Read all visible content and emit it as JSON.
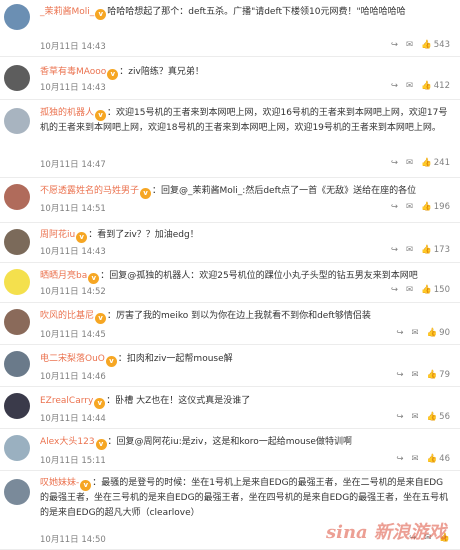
{
  "comments": [
    {
      "user": "_茉莉酱Moli_",
      "body": "哈哈哈想起了那个：deft五杀。广播\"请deft下楼领10元网费！\"哈哈哈哈哈",
      "time": "10月11日 14:43",
      "likes": "543",
      "avatar_color": "#6b8fb3"
    },
    {
      "user": "香草有毒MAooo",
      "body": "：ziv陪练？真兄弟！",
      "time": "10月11日 14:43",
      "likes": "412",
      "avatar_color": "#5d5d5d"
    },
    {
      "user": "孤独的机器人",
      "body": "：欢迎15号机的王者来到本网吧上网，欢迎16号机的王者来到本网吧上网，欢迎17号机的王者来到本网吧上网，欢迎18号机的王者来到本网吧上网，欢迎19号机的王者来到本网吧上网。",
      "time": "10月11日 14:47",
      "likes": "241",
      "avatar_color": "#a8b4c0"
    },
    {
      "user": "不愿透露姓名的马姓男子",
      "body": "：回复@_茉莉酱Moli_:然后deft点了一首《无敌》送给在座的各位",
      "time": "10月11日 14:51",
      "likes": "196",
      "avatar_color": "#b06b5b"
    },
    {
      "user": "周阿花iu",
      "body": "：看到了ziv？？加油edg！",
      "time": "10月11日 14:43",
      "likes": "173",
      "avatar_color": "#7b6a5a"
    },
    {
      "user": "晒晒月亮ba",
      "body": "：回复@孤独的机器人：欢迎25号机位的踝位小丸子头型的钻五男友来到本网吧",
      "time": "10月11日 14:52",
      "likes": "150",
      "avatar_color": "#f4e04d"
    },
    {
      "user": "吹风的比基尼",
      "body": "：厉害了我的meiko 到以为你在边上我就看不到你和deft够情侣装",
      "time": "10月11日 14:45",
      "likes": "90",
      "avatar_color": "#8a6a5a"
    },
    {
      "user": "电二宋梨落OuO",
      "body": "：扣肉和ziv一起帮mouse解",
      "time": "10月11日 14:46",
      "likes": "79",
      "avatar_color": "#6a7a8a"
    },
    {
      "user": "EZrealCarry",
      "body": "：卧槽 大Z也在！这仪式真是没谁了",
      "time": "10月11日 14:44",
      "likes": "56",
      "avatar_color": "#3a3a4a"
    },
    {
      "user": "Alex大头123",
      "body": "：回复@周阿花iu:是ziv，这是和koro一起给mouse做特训啊",
      "time": "10月11日 15:11",
      "likes": "46",
      "avatar_color": "#9ab0c0"
    },
    {
      "user": "叹她妹妹-",
      "body": "：最骚的是登号的时候：坐在1号机上是来自EDG的最强王者，坐在二号机的是来自EDG的最强王者，坐在三号机的是来自EDG的最强王者，坐在四号机的是来自EDG的最强王者，坐在五号机的是来自EDG的超凡大师（clearlove）",
      "time": "10月11日 14:50",
      "likes": "",
      "avatar_color": "#7a8a9a"
    }
  ],
  "watermark": "sina 新浪游戏"
}
